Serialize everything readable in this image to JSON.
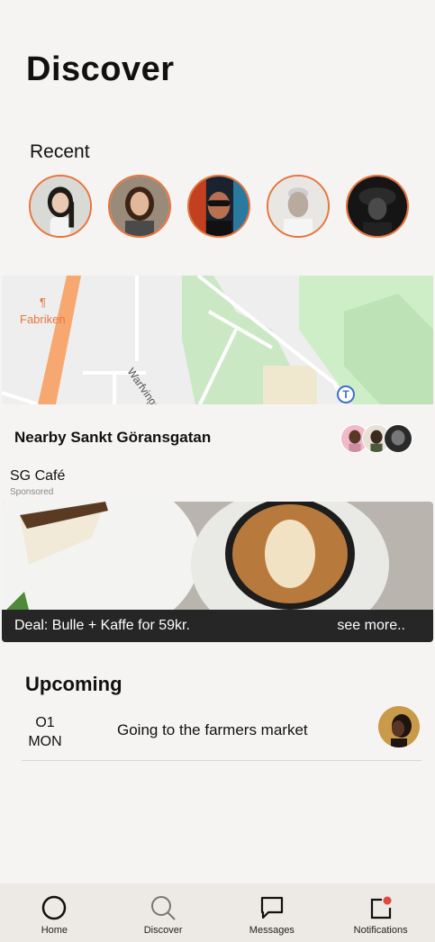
{
  "header": {
    "title": "Discover"
  },
  "recent": {
    "label": "Recent",
    "avatars": [
      {
        "name": "woman-avatar-1"
      },
      {
        "name": "woman-avatar-2"
      },
      {
        "name": "man-neon-avatar"
      },
      {
        "name": "older-man-avatar"
      },
      {
        "name": "man-hat-avatar"
      }
    ],
    "ring_color": "#e8743b"
  },
  "map": {
    "place_label": "Fabriken",
    "street_label": "Warfvinge",
    "transit_symbol": "T"
  },
  "nearby": {
    "label": "Nearby Sankt Göransgatan"
  },
  "cafe": {
    "name": "SG Café",
    "sponsored": "Sponsored",
    "deal": "Deal: Bulle + Kaffe for 59kr.",
    "see_more": "see more.."
  },
  "upcoming": {
    "label": "Upcoming",
    "events": [
      {
        "day_num": "O1",
        "day_name": "MON",
        "title": "Going to the farmers market"
      }
    ]
  },
  "tabbar": {
    "tabs": [
      {
        "label": "Home",
        "icon": "home-circle-icon"
      },
      {
        "label": "Discover",
        "icon": "search-icon"
      },
      {
        "label": "Messages",
        "icon": "chat-bubble-icon"
      },
      {
        "label": "Notifications",
        "icon": "bell-notification-icon"
      }
    ],
    "notification_dot_color": "#e2483d"
  }
}
